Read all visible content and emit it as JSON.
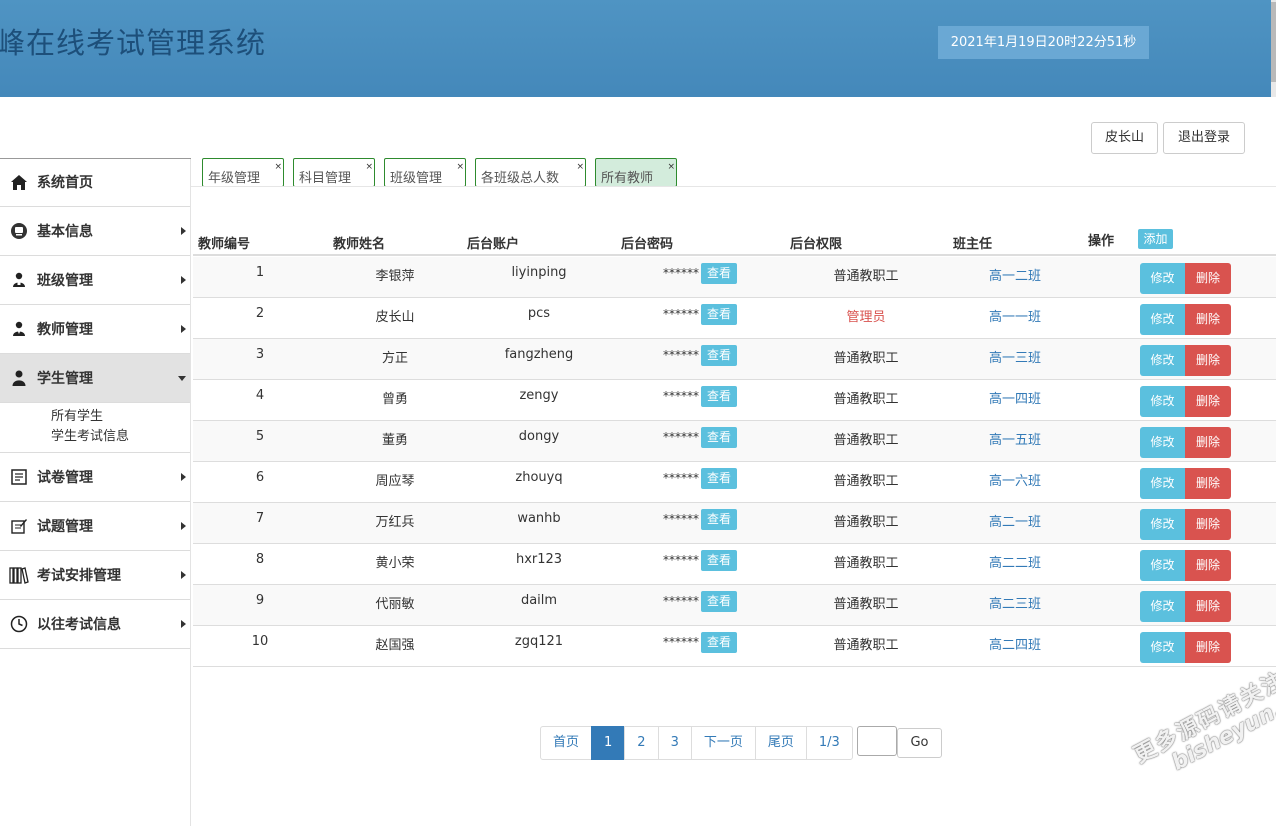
{
  "header": {
    "title": "峰在线考试管理系统",
    "clock": "2021年1月19日20时22分51秒"
  },
  "user": {
    "name": "皮长山",
    "logout": "退出登录"
  },
  "sidebar": {
    "items": [
      {
        "label": "系统首页",
        "icon": "home-icon"
      },
      {
        "label": "基本信息",
        "icon": "monitor-icon"
      },
      {
        "label": "班级管理",
        "icon": "users-icon"
      },
      {
        "label": "教师管理",
        "icon": "teacher-icon"
      },
      {
        "label": "学生管理",
        "icon": "user-icon"
      },
      {
        "label": "试卷管理",
        "icon": "paper-icon"
      },
      {
        "label": "试题管理",
        "icon": "edit-icon"
      },
      {
        "label": "考试安排管理",
        "icon": "books-icon"
      },
      {
        "label": "以往考试信息",
        "icon": "clock-icon"
      }
    ],
    "sub_items": [
      "所有学生",
      "学生考试信息"
    ]
  },
  "tabs": [
    {
      "label": "年级管理",
      "close": "×"
    },
    {
      "label": "科目管理",
      "close": "×"
    },
    {
      "label": "班级管理",
      "close": "×"
    },
    {
      "label": "各班级总人数",
      "close": "×"
    },
    {
      "label": "所有教师",
      "close": "×"
    }
  ],
  "table": {
    "headers": {
      "id": "教师编号",
      "name": "教师姓名",
      "account": "后台账户",
      "password": "后台密码",
      "role": "后台权限",
      "class": "班主任",
      "ops": "操作"
    },
    "add_label": "添加",
    "view_label": "查看",
    "edit_label": "修改",
    "delete_label": "删除",
    "rows": [
      {
        "id": "1",
        "name": "李银萍",
        "account": "liyinping",
        "password": "******",
        "role": "普通教职工",
        "class": "高一二班"
      },
      {
        "id": "2",
        "name": "皮长山",
        "account": "pcs",
        "password": "******",
        "role": "管理员",
        "class": "高一一班"
      },
      {
        "id": "3",
        "name": "方正",
        "account": "fangzheng",
        "password": "******",
        "role": "普通教职工",
        "class": "高一三班"
      },
      {
        "id": "4",
        "name": "曾勇",
        "account": "zengy",
        "password": "******",
        "role": "普通教职工",
        "class": "高一四班"
      },
      {
        "id": "5",
        "name": "董勇",
        "account": "dongy",
        "password": "******",
        "role": "普通教职工",
        "class": "高一五班"
      },
      {
        "id": "6",
        "name": "周应琴",
        "account": "zhouyq",
        "password": "******",
        "role": "普通教职工",
        "class": "高一六班"
      },
      {
        "id": "7",
        "name": "万红兵",
        "account": "wanhb",
        "password": "******",
        "role": "普通教职工",
        "class": "高二一班"
      },
      {
        "id": "8",
        "name": "黄小荣",
        "account": "hxr123",
        "password": "******",
        "role": "普通教职工",
        "class": "高二二班"
      },
      {
        "id": "9",
        "name": "代丽敏",
        "account": "dailm",
        "password": "******",
        "role": "普通教职工",
        "class": "高二三班"
      },
      {
        "id": "10",
        "name": "赵国强",
        "account": "zgq121",
        "password": "******",
        "role": "普通教职工",
        "class": "高二四班"
      }
    ]
  },
  "pagination": {
    "first": "首页",
    "pages": [
      "1",
      "2",
      "3"
    ],
    "next": "下一页",
    "last": "尾页",
    "info": "1/3",
    "go": "Go"
  },
  "watermark": {
    "line1": "更多源码请关注",
    "line2": "bisheyun.org"
  }
}
